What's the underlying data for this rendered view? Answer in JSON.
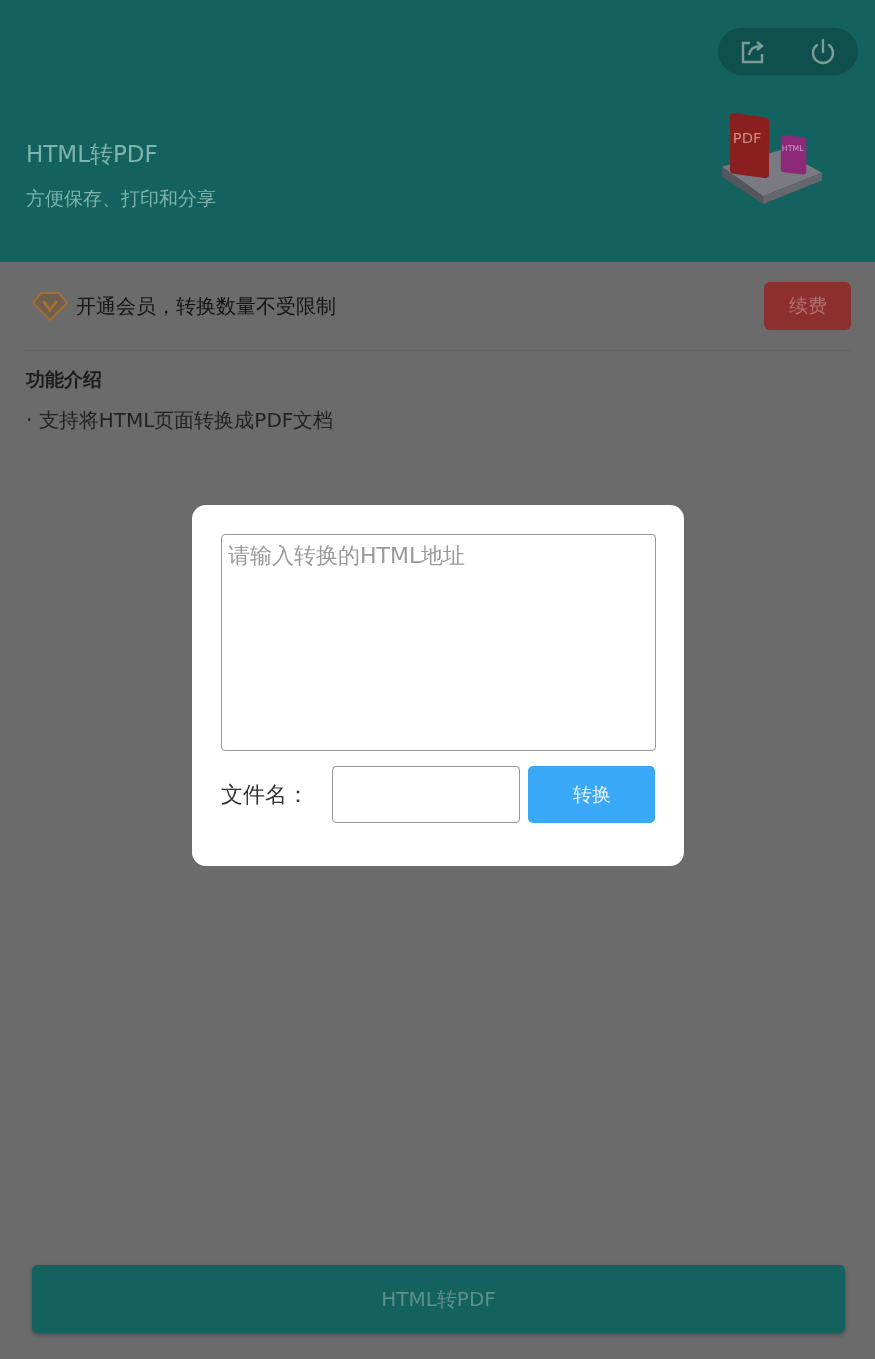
{
  "header": {
    "title": "HTML转PDF",
    "subtitle": "方便保存、打印和分享",
    "illustration_labels": [
      "PDF",
      "HTML"
    ]
  },
  "banner": {
    "text": "开通会员，转换数量不受限制",
    "button": "续费"
  },
  "features": {
    "title": "功能介绍",
    "items": [
      "· 支持将HTML页面转换成PDF文档"
    ]
  },
  "dialog": {
    "url_placeholder": "请输入转换的HTML地址",
    "filename_label": "文件名：",
    "convert_button": "转换"
  },
  "bottom_button": "HTML转PDF"
}
